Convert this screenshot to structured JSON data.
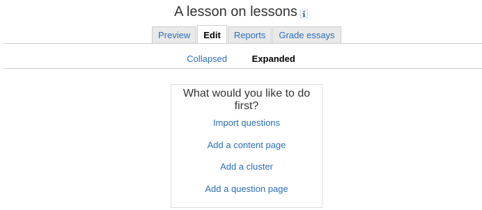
{
  "page": {
    "title": "A lesson on lessons",
    "help_icon": "info-icon"
  },
  "tabs": [
    {
      "label": "Preview",
      "active": false
    },
    {
      "label": "Edit",
      "active": true
    },
    {
      "label": "Reports",
      "active": false
    },
    {
      "label": "Grade essays",
      "active": false
    }
  ],
  "subtabs": {
    "collapsed": "Collapsed",
    "expanded": "Expanded",
    "selected": "Expanded"
  },
  "first_action": {
    "heading": "What would you like to do first?",
    "links": {
      "import_questions": "Import questions",
      "add_content_page": "Add a content page",
      "add_cluster": "Add a cluster",
      "add_question_page": "Add a question page"
    }
  },
  "colors": {
    "link": "#2a6ebb",
    "tab_background": "#e9e9e9",
    "border": "#cccccc"
  }
}
